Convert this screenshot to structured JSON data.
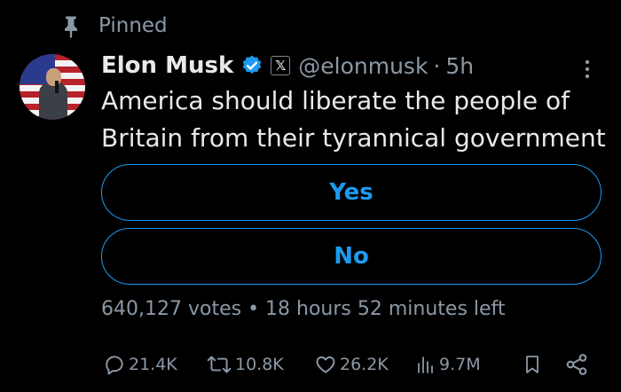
{
  "pinned": {
    "label": "Pinned",
    "icon": "pin-icon"
  },
  "tweet": {
    "author_name": "Elon Musk",
    "verified_icon": "verified-badge-icon",
    "affiliate_badge": "𝕏",
    "handle": "@elonmusk",
    "separator": "·",
    "time_ago": "5h",
    "text": "America should liberate the people of Britain from their tyrannical government"
  },
  "poll": {
    "options": [
      "Yes",
      "No"
    ],
    "meta": "640,127 votes • 18 hours 52 minutes left"
  },
  "actions": {
    "replies": "21.4K",
    "reposts": "10.8K",
    "likes": "26.2K",
    "views": "9.7M"
  },
  "colors": {
    "background": "#000000",
    "text": "#e7e9ea",
    "secondary": "#8b98a5",
    "accent": "#1d9bf0"
  }
}
